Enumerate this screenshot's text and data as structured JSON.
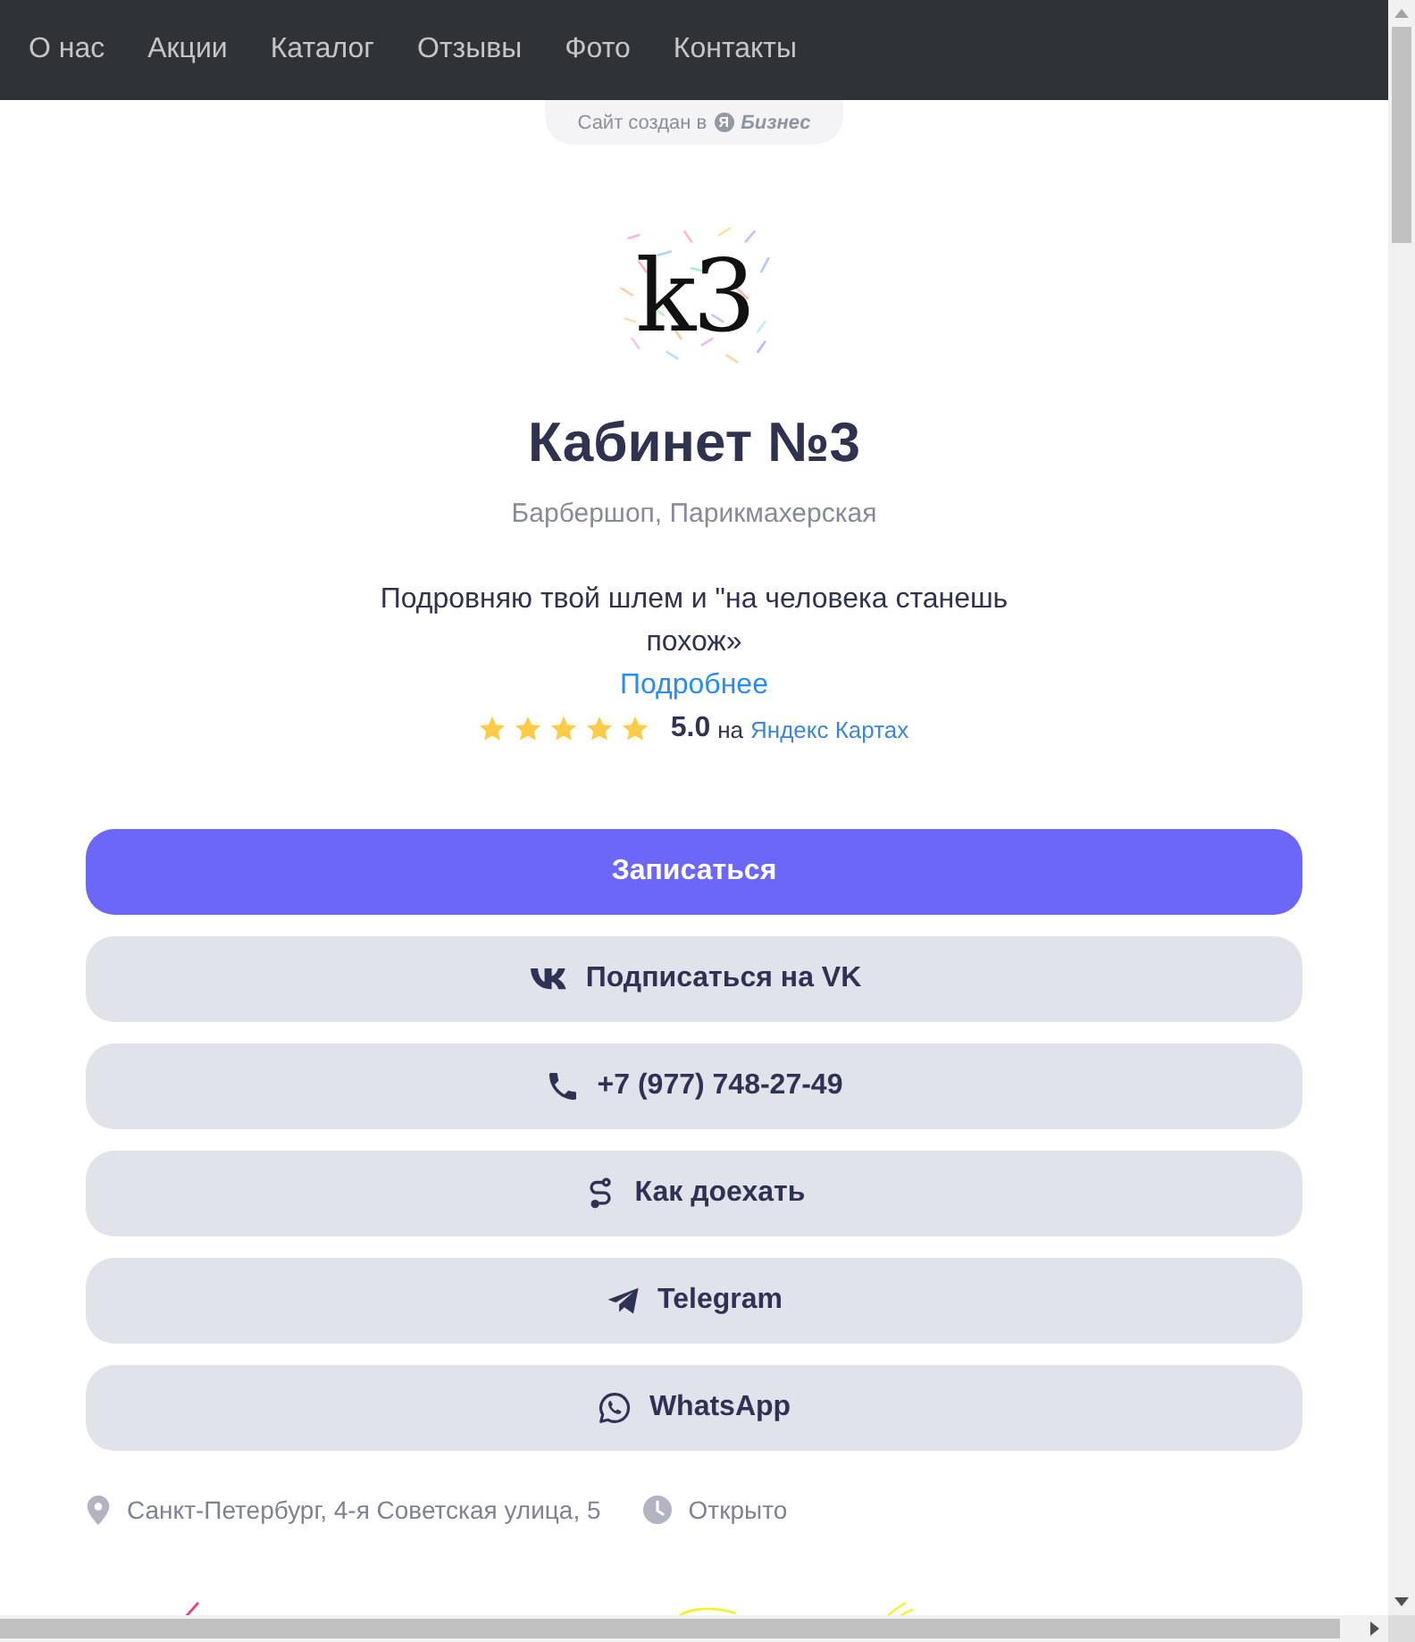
{
  "nav": {
    "items": [
      "О нас",
      "Акции",
      "Каталог",
      "Отзывы",
      "Фото",
      "Контакты"
    ]
  },
  "badge": {
    "text": "Сайт создан в",
    "mark": "Я",
    "brand": "Бизнес"
  },
  "logo": {
    "text": "k3"
  },
  "title": "Кабинет №3",
  "subtitle": "Барбершоп, Парикмахерская",
  "description": "Подровняю твой шлем и \"на человека станешь похож»",
  "more_link": "Подробнее",
  "rating": {
    "stars": 5,
    "score": "5.0",
    "on": "на",
    "source": "Яндекс Картах"
  },
  "buttons": [
    {
      "kind": "primary",
      "label": "Записаться"
    },
    {
      "kind": "vk",
      "label": "Подписаться на VK"
    },
    {
      "kind": "phone",
      "label": "+7 (977) 748-27-49"
    },
    {
      "kind": "route",
      "label": "Как доехать"
    },
    {
      "kind": "telegram",
      "label": "Telegram"
    },
    {
      "kind": "whatsapp",
      "label": "WhatsApp"
    }
  ],
  "info": [
    {
      "kind": "address",
      "text": "Санкт-Петербург, 4-я Советская улица, 5"
    },
    {
      "kind": "hours",
      "text": "Открыто"
    }
  ]
}
